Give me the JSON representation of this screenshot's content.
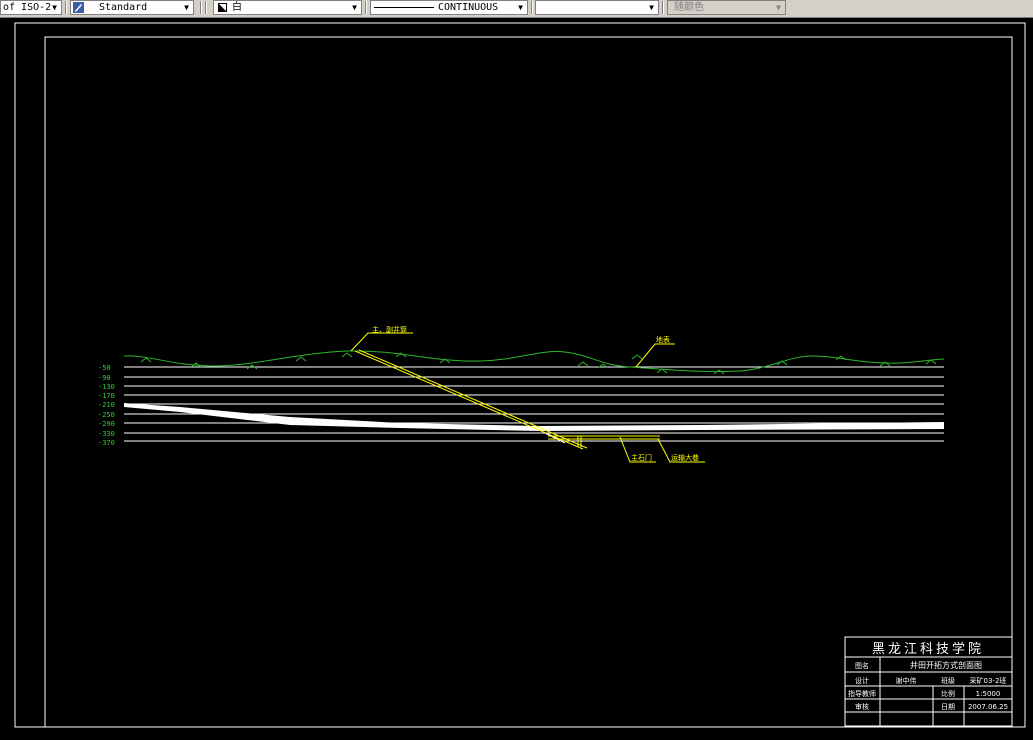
{
  "toolbar": {
    "dimstyle_value": "of ISO-2",
    "textstyle_value": "Standard",
    "color_value": "白",
    "linetype_value": "CONTINUOUS",
    "lineweight_value": "",
    "plotstyle_value": "随颜色"
  },
  "section": {
    "depth_labels": [
      "-50",
      "-90",
      "-130",
      "-170",
      "-210",
      "-250",
      "-290",
      "-330",
      "-370"
    ],
    "callouts": {
      "main_shaft": "主、副井筒",
      "surface": "地表",
      "hoist_gate": "主石门",
      "haulage": "运输大巷"
    }
  },
  "title_block": {
    "institution": "黑龙江科技学院",
    "drawing_name_label": "图名",
    "drawing_name": "井田开拓方式剖面图",
    "design_label": "设计",
    "designer": "谢中伟",
    "class_label": "班级",
    "class_value": "采矿03-2班",
    "advisor_label": "指导教师",
    "advisor": "",
    "scale_label": "比例",
    "scale": "1:5000",
    "review_label": "审核",
    "reviewer": "",
    "date_label": "日期",
    "date": "2007.06.25"
  },
  "colors": {
    "surface_line": "#2db52d",
    "depth_label": "#2fd02f",
    "callout_text": "#ffff00",
    "seam": "#ffffff",
    "frame": "#ffffff"
  }
}
